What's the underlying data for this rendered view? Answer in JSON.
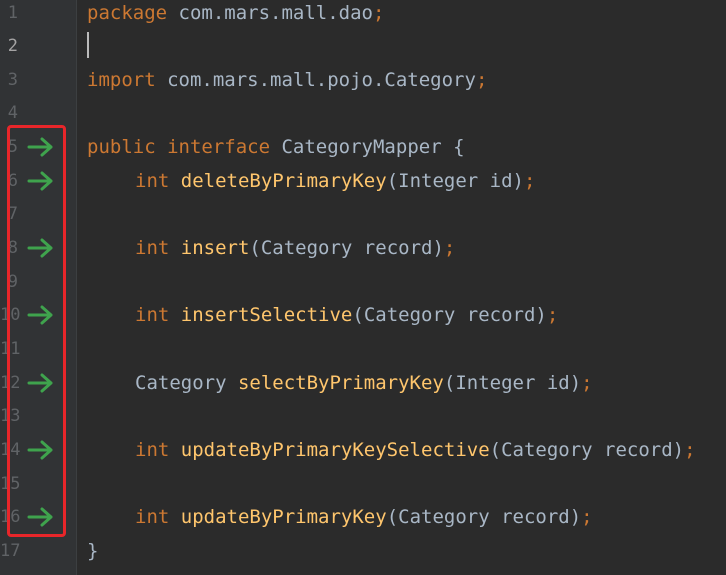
{
  "editor": {
    "line_numbers": [
      "1",
      "2",
      "3",
      "4",
      "5",
      "6",
      "7",
      "8",
      "9",
      "10",
      "11",
      "12",
      "13",
      "14",
      "15",
      "16",
      "17"
    ],
    "current_line": "2",
    "colors": {
      "background": "#2b2b2b",
      "gutter": "#313335",
      "keyword": "#cc7832",
      "method": "#ffc66d",
      "text": "#a9b7c6",
      "line_number": "#606366",
      "arrow_icon": "#3fa34d",
      "highlight_box": "#e8262a"
    },
    "gutter_icons": [
      {
        "line": "5",
        "icon": "implemented-arrow-icon"
      },
      {
        "line": "6",
        "icon": "implemented-arrow-icon"
      },
      {
        "line": "8",
        "icon": "implemented-arrow-icon"
      },
      {
        "line": "10",
        "icon": "implemented-arrow-icon"
      },
      {
        "line": "12",
        "icon": "implemented-arrow-icon"
      },
      {
        "line": "14",
        "icon": "implemented-arrow-icon"
      },
      {
        "line": "16",
        "icon": "implemented-arrow-icon"
      }
    ],
    "code": {
      "l1": {
        "kw": "package",
        "rest": " com.mars.mall.dao",
        "semi": ";"
      },
      "l3": {
        "kw": "import",
        "rest": " com.mars.mall.pojo.Category",
        "semi": ";"
      },
      "l5": {
        "kw1": "public",
        "kw2": "interface",
        "rest": " CategoryMapper {"
      },
      "l6": {
        "type": "int",
        "name": "deleteByPrimaryKey",
        "args": "(Integer id)",
        "semi": ";"
      },
      "l8": {
        "type": "int",
        "name": "insert",
        "args": "(Category record)",
        "semi": ";"
      },
      "l10": {
        "type": "int",
        "name": "insertSelective",
        "args": "(Category record)",
        "semi": ";"
      },
      "l12": {
        "type": "Category",
        "name": "selectByPrimaryKey",
        "args": "(Integer id)",
        "semi": ";"
      },
      "l14": {
        "type": "int",
        "name": "updateByPrimaryKeySelective",
        "args": "(Category record)",
        "semi": ";"
      },
      "l16": {
        "type": "int",
        "name": "updateByPrimaryKey",
        "args": "(Category record)",
        "semi": ";"
      },
      "l17": {
        "rest": "}"
      }
    }
  }
}
